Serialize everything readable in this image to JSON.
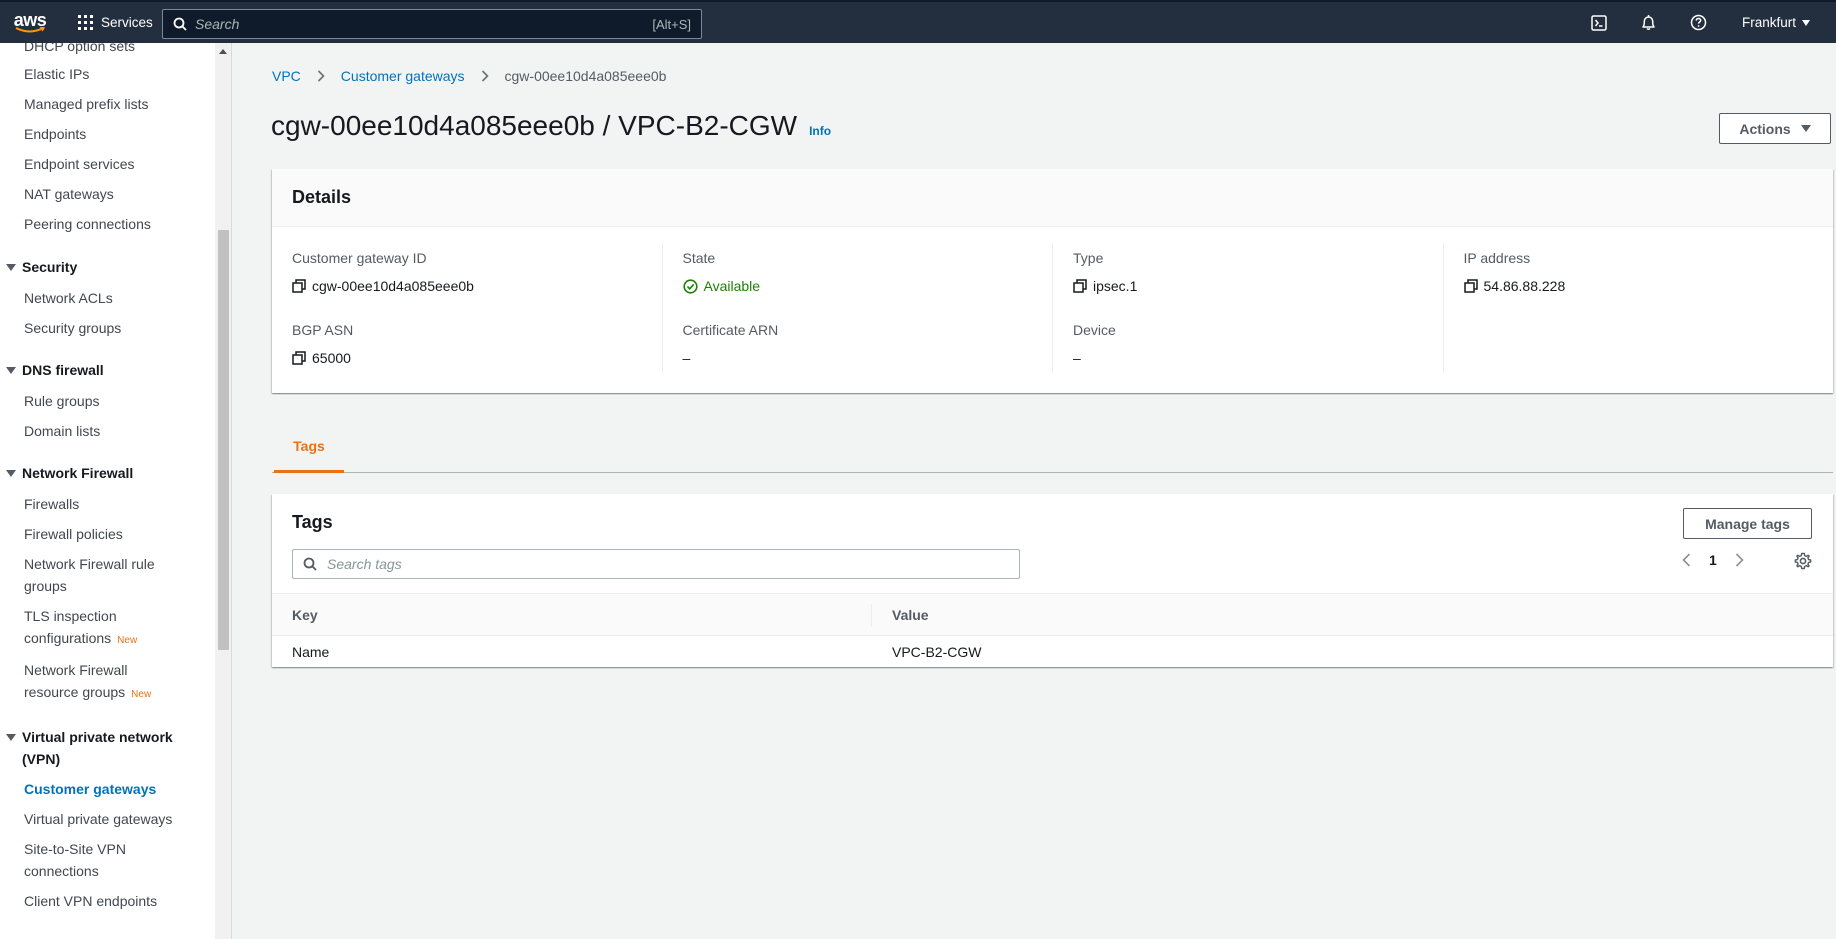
{
  "topnav": {
    "logo": "aws",
    "services_label": "Services",
    "search_placeholder": "Search",
    "search_shortcut": "[Alt+S]",
    "region": "Frankfurt",
    "icons": [
      "cloudshell-icon",
      "notifications-bell-icon",
      "help-icon"
    ]
  },
  "sidebar": {
    "items_top": [
      "DHCP option sets",
      "Elastic IPs",
      "Managed prefix lists",
      "Endpoints",
      "Endpoint services",
      "NAT gateways",
      "Peering connections"
    ],
    "security": {
      "title": "Security",
      "items": [
        "Network ACLs",
        "Security groups"
      ]
    },
    "dns_firewall": {
      "title": "DNS firewall",
      "items": [
        "Rule groups",
        "Domain lists"
      ]
    },
    "network_firewall": {
      "title": "Network Firewall",
      "items": [
        "Firewalls",
        "Firewall policies",
        "Network Firewall rule groups",
        "TLS inspection configurations",
        "Network Firewall resource groups"
      ],
      "new_badge": "New"
    },
    "vpn": {
      "title": "Virtual private network (VPN)",
      "items": [
        "Customer gateways",
        "Virtual private gateways",
        "Site-to-Site VPN connections",
        "Client VPN endpoints"
      ],
      "active": "Customer gateways"
    }
  },
  "breadcrumb": {
    "root": "VPC",
    "parent": "Customer gateways",
    "current": "cgw-00ee10d4a085eee0b"
  },
  "page": {
    "title": "cgw-00ee10d4a085eee0b / VPC-B2-CGW",
    "info": "Info",
    "actions": "Actions"
  },
  "details": {
    "heading": "Details",
    "customer_gateway_id_label": "Customer gateway ID",
    "customer_gateway_id": "cgw-00ee10d4a085eee0b",
    "bgp_asn_label": "BGP ASN",
    "bgp_asn": "65000",
    "state_label": "State",
    "state": "Available",
    "certificate_arn_label": "Certificate ARN",
    "certificate_arn": "–",
    "type_label": "Type",
    "type": "ipsec.1",
    "device_label": "Device",
    "device": "–",
    "ip_address_label": "IP address",
    "ip_address": "54.86.88.228",
    "status_color": "#1d8102"
  },
  "tabs": {
    "tags": "Tags"
  },
  "tags_panel": {
    "title": "Tags",
    "manage_button": "Manage tags",
    "search_placeholder": "Search tags",
    "page": "1",
    "columns": {
      "key": "Key",
      "value": "Value"
    },
    "rows": [
      {
        "key": "Name",
        "value": "VPC-B2-CGW"
      }
    ]
  },
  "colors": {
    "nav_bg": "#232f3e",
    "link": "#0073bb",
    "accent": "#ec7211"
  }
}
